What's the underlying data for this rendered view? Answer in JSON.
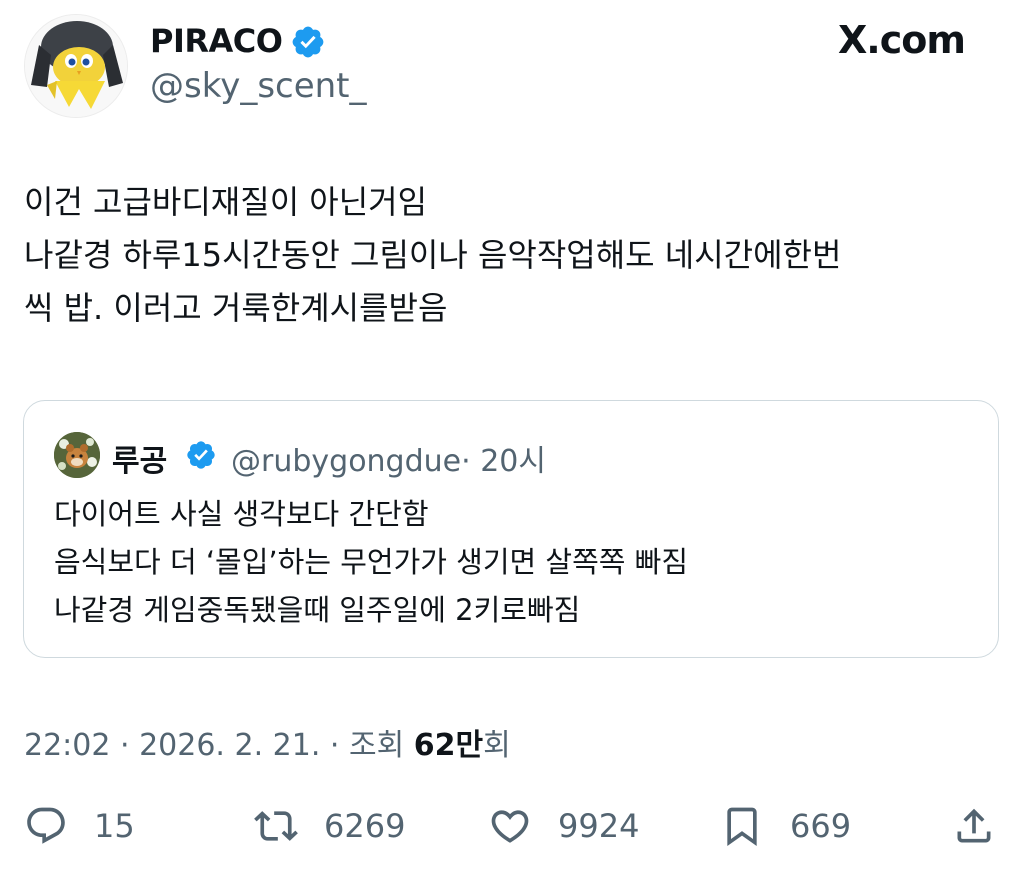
{
  "author": {
    "display_name": "PIRACO",
    "handle": "@sky_scent_"
  },
  "brand": {
    "logo_text": "X.com"
  },
  "tweet": {
    "text": "이건 고급바디재질이 아닌거임\n나같경 하루15시간동안 그림이나 음악작업해도 네시간에한번\n씩 밥. 이러고 거룩한계시를받음"
  },
  "quote": {
    "display_name": "루공",
    "handle": "@rubygongdue",
    "time": "· 20시",
    "text": "다이어트 사실 생각보다 간단함\n음식보다 더 ‘몰입’하는 무언가가 생기면 살쪽쪽 빠짐\n나같경 게임중독됐을때 일주일에 2키로빠짐"
  },
  "meta": {
    "time": "22:02",
    "date": "2026. 2. 21.",
    "views_label": "조회",
    "views_count": "62만",
    "views_suffix": "회"
  },
  "actions": {
    "reply_count": "15",
    "retweet_count": "6269",
    "like_count": "9924",
    "bookmark_count": "669"
  },
  "colors": {
    "verified": "#1d9bf0",
    "secondary_text": "#536471",
    "border": "#cfd9de"
  },
  "icons": [
    "verified-badge-icon",
    "reply-icon",
    "retweet-icon",
    "like-icon",
    "bookmark-icon",
    "share-icon"
  ]
}
